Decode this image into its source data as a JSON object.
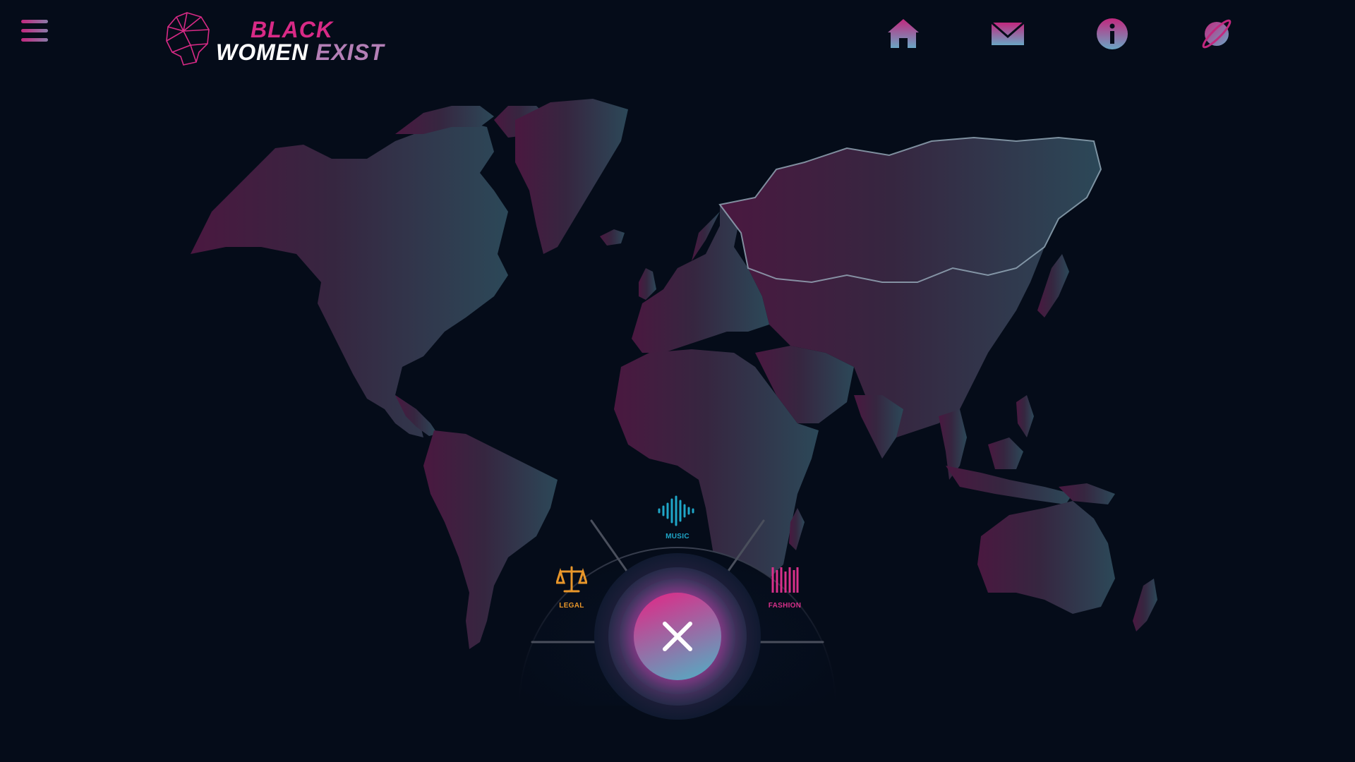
{
  "header": {
    "menu_icon": "hamburger-menu-icon",
    "logo": {
      "line1": "BLACK",
      "line2a": "WOMEN",
      "line2b": "EXIST",
      "icon": "head-network-icon"
    },
    "nav": [
      {
        "icon": "home-icon"
      },
      {
        "icon": "mail-icon"
      },
      {
        "icon": "info-icon"
      },
      {
        "icon": "planet-icon"
      }
    ]
  },
  "map": {
    "icon": "world-map",
    "gradient": [
      "#4a1a45",
      "#2d2a44",
      "#2e4a5a"
    ]
  },
  "radial_menu": {
    "items": [
      {
        "label": "MUSIC",
        "icon": "soundwave-icon",
        "color": "#1fa6c8"
      },
      {
        "label": "LEGAL",
        "icon": "scales-icon",
        "color": "#e8962a"
      },
      {
        "label": "FASHION",
        "icon": "barcode-icon",
        "color": "#d8308a"
      }
    ],
    "close_icon": "close-icon"
  },
  "colors": {
    "background": "#050c19",
    "accent_pink": "#d82a86",
    "accent_teal": "#5aa6c0"
  }
}
